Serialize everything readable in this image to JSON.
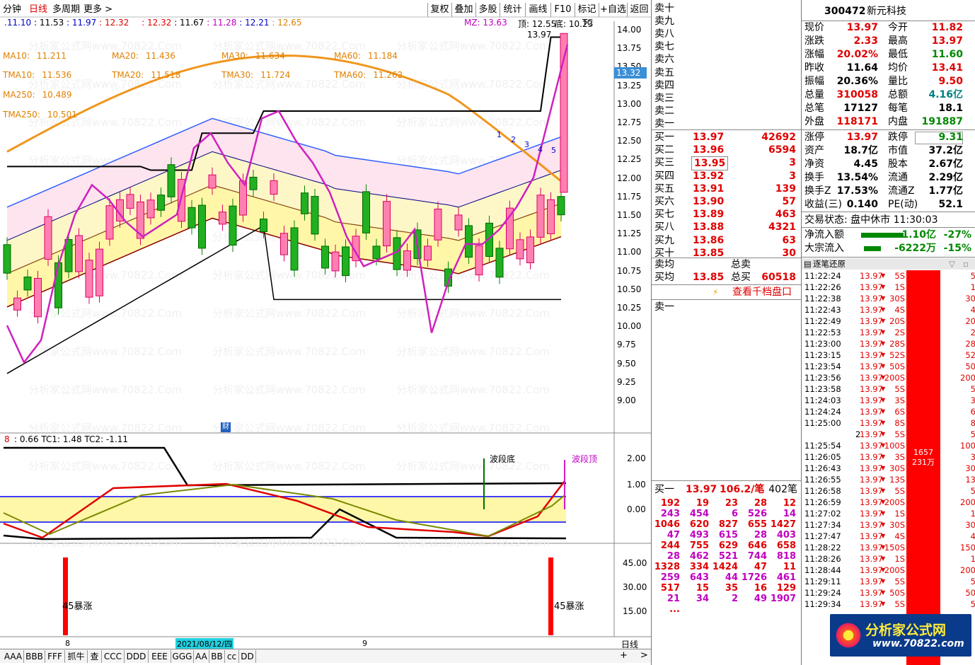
{
  "toolbar": {
    "period_prefix": "分钟",
    "daily": "日线",
    "multi_period": "多周期",
    "more": "更多 >",
    "buttons": [
      "复权",
      "叠加",
      "多股",
      "统计",
      "画线",
      "F10",
      "标记",
      "+自选",
      "返回"
    ]
  },
  "ma_header": {
    "row1": [
      ".11.10",
      ": 11.53",
      ": 11.97",
      ": 12.32",
      ": 12.32",
      ": 11.67",
      ": 11.28",
      ": 12.21",
      ": 12.65"
    ],
    "mz": "MZ: 13.63",
    "top": "顶: 12.55",
    "bottom": "底: 10.23",
    "tc": "TC"
  },
  "ma_labels": [
    {
      "name": "MA10:",
      "value": "11.211"
    },
    {
      "name": "MA20:",
      "value": "11.436"
    },
    {
      "name": "MA30:",
      "value": "11.634"
    },
    {
      "name": "MA60:",
      "value": "11.184"
    },
    {
      "name": "TMA10:",
      "value": "11.536"
    },
    {
      "name": "TMA20:",
      "value": "11.518"
    },
    {
      "name": "TMA30:",
      "value": "11.724"
    },
    {
      "name": "TMA60:",
      "value": "11.262"
    },
    {
      "name": "MA250:",
      "value": "10.489"
    },
    {
      "name": "TMA250:",
      "value": "10.501"
    }
  ],
  "price_axis": [
    "14.00",
    "13.75",
    "13.50",
    "13.25",
    "13.00",
    "12.75",
    "12.50",
    "12.25",
    "12.00",
    "11.75",
    "11.50",
    "11.25",
    "11.00",
    "10.75",
    "10.50",
    "10.25",
    "10.00",
    "9.75",
    "9.50",
    "9.25",
    "9.00"
  ],
  "current_price_tag": "13.32",
  "high_label": "13.97",
  "wave_numbers": [
    "1",
    "2",
    "3",
    "4",
    "5"
  ],
  "sub1": {
    "header": ": 0.66  TC1: 1.48  TC2: -1.11",
    "header_prefix": "8",
    "axis": [
      "2.00",
      "1.00",
      "0.00"
    ],
    "wave_bottom": "波段底",
    "wave_top": "波段顶"
  },
  "sub2": {
    "axis": [
      "45.00",
      "30.00",
      "15.00"
    ],
    "label1": "45暴涨",
    "label2": "45暴涨"
  },
  "date_axis": {
    "d1": "8",
    "date": "2021/08/12/四",
    "d2": "9",
    "period": "日线"
  },
  "cai_icon": "财",
  "bottom_tabs": [
    "AAA",
    "BBB",
    "FFF",
    "抓牛",
    "查",
    "CCC",
    "DDD",
    "EEE",
    "GGG",
    "AA",
    "BB",
    "cc",
    "DD"
  ],
  "sell_labels": [
    "卖十",
    "卖九",
    "卖八",
    "卖七",
    "卖六",
    "卖五",
    "卖四",
    "卖三",
    "卖二",
    "卖一"
  ],
  "buy_rows": [
    {
      "label": "买一",
      "price": "13.97",
      "vol": "42692"
    },
    {
      "label": "买二",
      "price": "13.96",
      "vol": "6594"
    },
    {
      "label": "买三",
      "price": "13.95",
      "vol": "3"
    },
    {
      "label": "买四",
      "price": "13.92",
      "vol": "3"
    },
    {
      "label": "买五",
      "price": "13.91",
      "vol": "139"
    },
    {
      "label": "买六",
      "price": "13.90",
      "vol": "57"
    },
    {
      "label": "买七",
      "price": "13.89",
      "vol": "463"
    },
    {
      "label": "买八",
      "price": "13.88",
      "vol": "4321"
    },
    {
      "label": "买九",
      "price": "13.86",
      "vol": "63"
    },
    {
      "label": "买十",
      "price": "13.85",
      "vol": "30"
    }
  ],
  "avg": {
    "sell_avg": "卖均",
    "total_sell": "总卖",
    "buy_avg": "买均",
    "buy_avg_price": "13.85",
    "total_buy": "总买",
    "total_buy_val": "60518"
  },
  "thousand_link": "查看千档盘口",
  "sell1_label": "卖一",
  "buy1_summary": {
    "label": "买一",
    "price": "13.97",
    "per": "106.2/笔",
    "count": "402笔"
  },
  "buy1_grid": [
    [
      "192",
      "19",
      "23",
      "28",
      "12"
    ],
    [
      "243",
      "454",
      "6",
      "526",
      "14"
    ],
    [
      "1046",
      "620",
      "827",
      "655",
      "1427"
    ],
    [
      "47",
      "493",
      "615",
      "28",
      "403"
    ],
    [
      "244",
      "755",
      "629",
      "646",
      "658"
    ],
    [
      "28",
      "462",
      "521",
      "744",
      "818"
    ],
    [
      "1328",
      "334",
      "1424",
      "47",
      "11"
    ],
    [
      "259",
      "643",
      "44",
      "1726",
      "461"
    ],
    [
      "517",
      "15",
      "35",
      "16",
      "129"
    ],
    [
      "21",
      "34",
      "2",
      "49",
      "1907"
    ],
    [
      "...",
      "",
      "",
      "",
      ""
    ]
  ],
  "stock": {
    "code": "300472",
    "name": "新元科技"
  },
  "quote": [
    {
      "l1": "现价",
      "v1": "13.97",
      "c1": "red",
      "l2": "今开",
      "v2": "11.82",
      "c2": "red"
    },
    {
      "l1": "涨跌",
      "v1": "2.33",
      "c1": "red",
      "l2": "最高",
      "v2": "13.97",
      "c2": "red"
    },
    {
      "l1": "涨幅",
      "v1": "20.02%",
      "c1": "red",
      "l2": "最低",
      "v2": "11.60",
      "c2": "green"
    },
    {
      "l1": "昨收",
      "v1": "11.64",
      "c1": "black",
      "l2": "均价",
      "v2": "13.41",
      "c2": "red"
    },
    {
      "l1": "振幅",
      "v1": "20.36%",
      "c1": "black",
      "l2": "量比",
      "v2": "9.50",
      "c2": "red"
    },
    {
      "l1": "总量",
      "v1": "310058",
      "c1": "red",
      "l2": "总额",
      "v2": "4.16亿",
      "c2": "teal"
    },
    {
      "l1": "总笔",
      "v1": "17127",
      "c1": "black",
      "l2": "每笔",
      "v2": "18.1",
      "c2": "black"
    },
    {
      "l1": "外盘",
      "v1": "118171",
      "c1": "red",
      "l2": "内盘",
      "v2": "191887",
      "c2": "green"
    }
  ],
  "limits": [
    {
      "l1": "涨停",
      "v1": "13.97",
      "c1": "red",
      "l2": "跌停",
      "v2": "9.31",
      "c2": "green"
    },
    {
      "l1": "资产",
      "v1": "18.7亿",
      "c1": "black",
      "l2": "市值",
      "v2": "37.2亿",
      "c2": "black"
    },
    {
      "l1": "净资",
      "v1": "4.45",
      "c1": "black",
      "l2": "股本",
      "v2": "2.67亿",
      "c2": "black"
    },
    {
      "l1": "换手",
      "v1": "13.54%",
      "c1": "black",
      "l2": "流通",
      "v2": "2.29亿",
      "c2": "black"
    },
    {
      "l1": "换手Z",
      "v1": "17.53%",
      "c1": "black",
      "l2": "流通Z",
      "v2": "1.77亿",
      "c2": "black"
    },
    {
      "l1": "收益(三)",
      "v1": "0.140",
      "c1": "black",
      "l2": "PE(动)",
      "v2": "52.1",
      "c2": "black"
    }
  ],
  "trade_status": "交易状态: 盘中休市 11:30:03",
  "flows": [
    {
      "label": "净流入额",
      "value": "-1.10亿",
      "pct": "-27%"
    },
    {
      "label": "大宗流入",
      "value": "-6222万",
      "pct": "-15%"
    }
  ],
  "ticks_title": "逐笔还原",
  "ticks": [
    {
      "t": "11:22:24",
      "p": "13.97",
      "v": "5S",
      "r": "5"
    },
    {
      "t": "11:22:26",
      "p": "13.97",
      "v": "1S",
      "r": "1"
    },
    {
      "t": "11:22:38",
      "p": "13.97",
      "v": "30S",
      "r": "30"
    },
    {
      "t": "11:22:43",
      "p": "13.97",
      "v": "4S",
      "r": "4"
    },
    {
      "t": "11:22:49",
      "p": "13.97",
      "v": "20S",
      "r": "20"
    },
    {
      "t": "11:22:53",
      "p": "13.97",
      "v": "2S",
      "r": "2"
    },
    {
      "t": "11:23:00",
      "p": "13.97",
      "v": "28S",
      "r": "28"
    },
    {
      "t": "11:23:15",
      "p": "13.97",
      "v": "52S",
      "r": "52"
    },
    {
      "t": "11:23:54",
      "p": "13.97",
      "v": "50S",
      "r": "50"
    },
    {
      "t": "11:23:56",
      "p": "13.97",
      "v": "200S",
      "r": "200"
    },
    {
      "t": "11:23:58",
      "p": "13.97",
      "v": "5S",
      "r": "5"
    },
    {
      "t": "11:24:03",
      "p": "13.97",
      "v": "3S",
      "r": "3"
    },
    {
      "t": "11:24:24",
      "p": "13.97",
      "v": "6S",
      "r": "6"
    },
    {
      "t": "11:25:00",
      "p": "13.97",
      "v": "8S",
      "r": "8"
    },
    {
      "t": "2",
      "p": "13.97",
      "v": "5S",
      "r": "5"
    },
    {
      "t": "11:25:54",
      "p": "13.97",
      "v": "100S",
      "r": "100"
    },
    {
      "t": "11:26:05",
      "p": "13.97",
      "v": "3S",
      "r": "3"
    },
    {
      "t": "11:26:43",
      "p": "13.97",
      "v": "30S",
      "r": "30"
    },
    {
      "t": "11:26:55",
      "p": "13.97",
      "v": "13S",
      "r": "13"
    },
    {
      "t": "11:26:58",
      "p": "13.97",
      "v": "5S",
      "r": "5"
    },
    {
      "t": "11:26:59",
      "p": "13.97",
      "v": "200S",
      "r": "200"
    },
    {
      "t": "11:27:02",
      "p": "13.97",
      "v": "1S",
      "r": "1"
    },
    {
      "t": "11:27:34",
      "p": "13.97",
      "v": "30S",
      "r": "30"
    },
    {
      "t": "11:27:47",
      "p": "13.97",
      "v": "4S",
      "r": "4"
    },
    {
      "t": "11:28:22",
      "p": "13.97",
      "v": "150S",
      "r": "150"
    },
    {
      "t": "11:28:26",
      "p": "13.97",
      "v": "1S",
      "r": "1"
    },
    {
      "t": "11:28:44",
      "p": "13.97",
      "v": "200S",
      "r": "200"
    },
    {
      "t": "11:29:11",
      "p": "13.97",
      "v": "5S",
      "r": "5"
    },
    {
      "t": "11:29:24",
      "p": "13.97",
      "v": "50S",
      "r": "50"
    },
    {
      "t": "11:29:34",
      "p": "13.97",
      "v": "5S",
      "r": "5"
    }
  ],
  "big_order": {
    "count": "1657",
    "amount": "231万"
  },
  "logo": {
    "text": "分析家公式网",
    "url": "www.70822.com"
  },
  "watermark": "分析家公式网www.70822.Com"
}
